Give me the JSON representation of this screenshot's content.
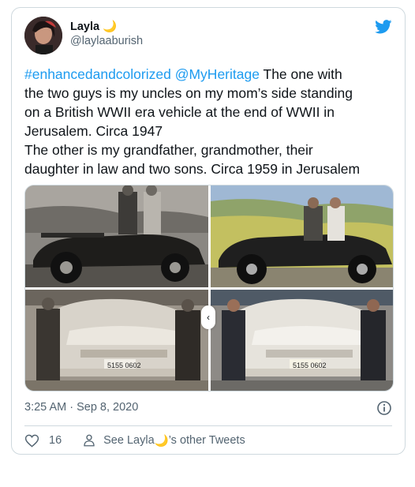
{
  "tweet": {
    "author_name": "Layla",
    "author_emoji": "🌙",
    "handle": "@laylaaburish",
    "hashtag": "#enhancedandcolorized",
    "mention": "@MyHeritage",
    "text_line1_rest": " The one with",
    "text_line2": "the two guys is my uncles on my mom’s side standing",
    "text_line3": "on a British WWII era vehicle at the end of WWII in",
    "text_line4": "Jerusalem. Circa 1947",
    "text_line5": "The other is my grandfather, grandmother, their",
    "text_line6": "daughter in law and two sons. Circa 1959 in Jerusalem",
    "timestamp": "3:25 AM · Sep 8, 2020",
    "likes": "16",
    "see_other_prefix": "See Layla ",
    "see_other_suffix": "’s other Tweets"
  },
  "photos": [
    {
      "plate_text": ""
    },
    {
      "plate_text": ""
    },
    {
      "plate_text": "5155 0602"
    },
    {
      "plate_text": "5155 0602"
    }
  ],
  "colors": {
    "link": "#1d9bf0",
    "secondary_text": "#536471",
    "border": "#cfd9de",
    "twitter_blue": "#1d9bf0"
  },
  "icons": {
    "bird": "twitter-bird-icon",
    "info": "info-icon",
    "like": "heart-icon",
    "profile": "person-icon"
  }
}
